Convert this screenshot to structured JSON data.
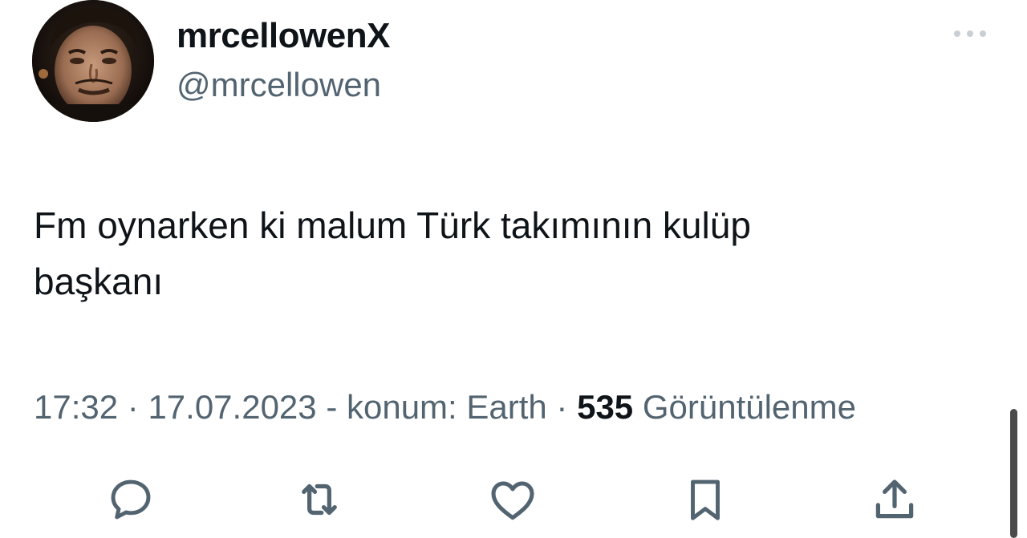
{
  "user": {
    "display_name": "mrcellowenX",
    "handle": "@mrcellowen",
    "avatar": "profile-photo"
  },
  "tweet": {
    "text": "Fm oynarken ki malum Türk takımının kulüp\nbaşkanı"
  },
  "meta": {
    "time": "17:32",
    "separator1": " · ",
    "date": "17.07.2023",
    "location": " - konum: Earth",
    "separator2": " · ",
    "views_count": "535",
    "views_label": " Görüntülenme"
  },
  "actions": [
    {
      "name": "reply",
      "icon": "comment-icon"
    },
    {
      "name": "retweet",
      "icon": "retweet-icon"
    },
    {
      "name": "like",
      "icon": "heart-icon"
    },
    {
      "name": "bookmark",
      "icon": "bookmark-icon"
    },
    {
      "name": "share",
      "icon": "share-icon"
    }
  ],
  "colors": {
    "text": "#0f1419",
    "secondary": "#536471",
    "icon": "#536471"
  }
}
